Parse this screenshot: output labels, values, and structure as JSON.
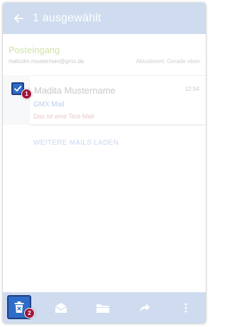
{
  "appbar": {
    "title": "1 ausgewählt",
    "back_icon": "arrow-back-icon"
  },
  "folder": {
    "name": "Posteingang",
    "account": "malcolm.musterman@gmx.de",
    "status": "Aktualisiert: Gerade eben"
  },
  "mail": {
    "sender": "Madita Mustername",
    "time": "12:54",
    "subject": "GMX Mail",
    "preview": "Das ist eine Test-Mail",
    "selected": true
  },
  "load_more": "WEITERE MAILS LADEN",
  "badges": {
    "first": "1",
    "second": "2"
  },
  "bottombar": {
    "actions": [
      {
        "name": "delete",
        "icon": "trash-icon"
      },
      {
        "name": "mark-read",
        "icon": "envelope-open-icon"
      },
      {
        "name": "move",
        "icon": "folder-icon"
      },
      {
        "name": "forward",
        "icon": "forward-arrow-icon"
      },
      {
        "name": "more",
        "icon": "more-vert-icon"
      }
    ]
  },
  "colors": {
    "appbar": "#cfdcef",
    "highlight": "#2f6cc7",
    "badge": "#a0163a",
    "folder_name": "#cfe3ad"
  }
}
